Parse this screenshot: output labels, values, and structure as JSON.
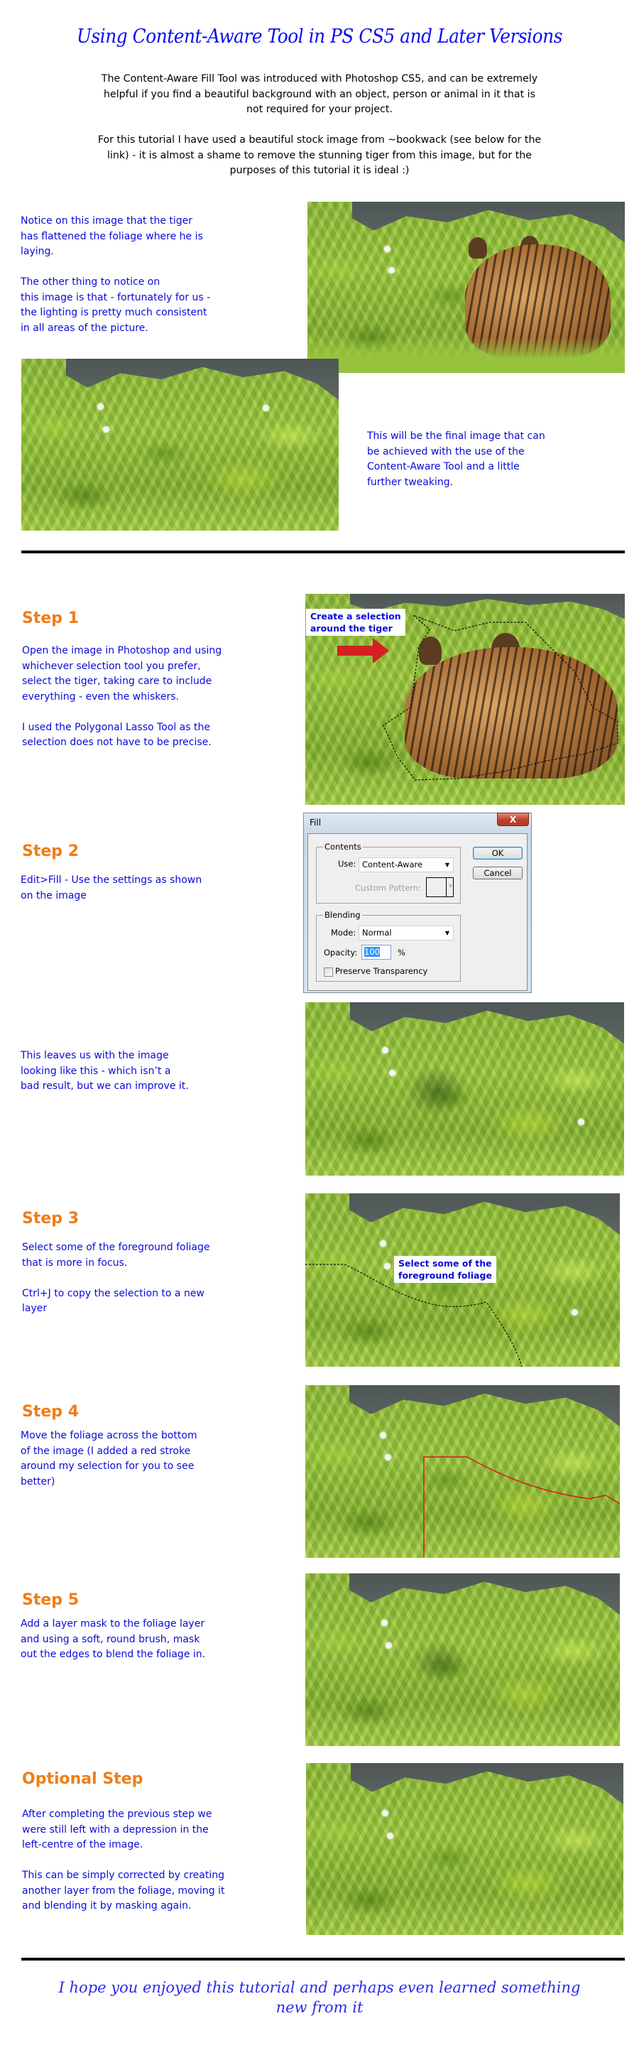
{
  "title": "Using Content-Aware Tool in PS CS5 and Later Versions",
  "intro": {
    "paragraph1": [
      "The Content-Aware Fill Tool was introduced with Photoshop CS5, and can be extremely",
      "helpful if you find a beautiful background with an object, person or animal in it that is",
      "not required for your project."
    ],
    "paragraph2": [
      "For this tutorial I have used a beautiful stock image from ~bookwack (see below for the",
      "link) - it is almost a shame to remove the stunning tiger from this image, but for the",
      "purposes of this tutorial it is ideal :)"
    ]
  },
  "overview": {
    "notice_lines": [
      "Notice on this image that the tiger",
      "has flattened the foliage where he is",
      "laying.",
      "",
      "The other thing to notice on",
      "this image is that - fortunately for us -",
      "the lighting is pretty much consistent",
      "in all areas of the picture."
    ],
    "final_lines": [
      "This will be the final image that can",
      "be achieved with the use of the",
      "Content-Aware Tool and a little",
      "further tweaking."
    ]
  },
  "steps": {
    "step1": {
      "heading": "Step 1",
      "lines": [
        "Open the image in Photoshop and using",
        "whichever selection tool you prefer,",
        "select the tiger, taking care to include",
        "everything - even the whiskers.",
        "",
        "I used the Polygonal Lasso Tool as the",
        "selection does not have to be precise."
      ],
      "callout": [
        "Create a selection",
        "around the tiger"
      ]
    },
    "step2": {
      "heading": "Step 2",
      "lines": [
        "Edit>Fill - Use the settings as shown",
        "on the image"
      ],
      "result_lines": [
        "This leaves us with the image",
        "looking like this - which isn’t a",
        "bad result, but we can improve it."
      ]
    },
    "step3": {
      "heading": "Step 3",
      "lines": [
        "Select some of the foreground foliage",
        "that is more in focus.",
        "",
        "Ctrl+J to copy the selection to a new",
        "layer"
      ],
      "callout": [
        "Select some of the",
        "foreground foliage"
      ]
    },
    "step4": {
      "heading": "Step 4",
      "lines": [
        "Move the foliage across the bottom",
        "of the image (I added a red stroke",
        "around my selection for you to see",
        "better)"
      ]
    },
    "step5": {
      "heading": "Step 5",
      "lines": [
        "Add a layer mask to the foliage layer",
        "and using a soft, round brush, mask",
        "out the edges to blend the foliage in."
      ]
    },
    "optional": {
      "heading": "Optional Step",
      "lines": [
        "After completing the previous step we",
        "were still left with a depression in the",
        "left-centre of the image.",
        "",
        "This can be simply corrected by creating",
        "another layer from the foliage, moving it",
        "and blending it by masking again."
      ]
    }
  },
  "fill_dialog": {
    "title": "Fill",
    "close_label": "X",
    "contents_label": "Contents",
    "use_label": "Use:",
    "use_value": "Content-Aware",
    "custom_pattern_label": "Custom Pattern:",
    "blending_label": "Blending",
    "mode_label": "Mode:",
    "mode_value": "Normal",
    "opacity_label": "Opacity:",
    "opacity_value": "100",
    "opacity_unit": "%",
    "preserve_label": "Preserve Transparency",
    "preserve_checked": false,
    "ok_label": "OK",
    "cancel_label": "Cancel"
  },
  "footer": {
    "lines": [
      "I hope you enjoyed this tutorial and perhaps even learned something",
      "new from it"
    ]
  },
  "colors": {
    "title": "#0a0af0",
    "body_blue": "#0a0ad8",
    "step_heading": "#f07d17",
    "selection_stroke": "#d41e1e",
    "footer": "#2a2aee"
  }
}
